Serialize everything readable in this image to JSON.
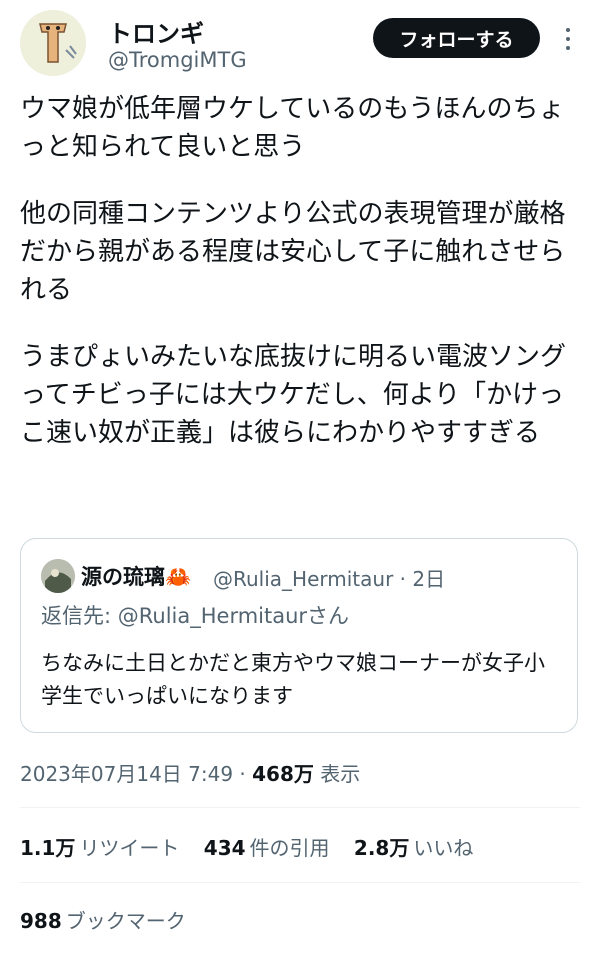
{
  "author": {
    "name": "トロンギ",
    "handle": "@TromgiMTG",
    "avatar_icon": "cartoon-character-avatar-icon"
  },
  "follow_button": {
    "label": "フォローする"
  },
  "more_button": {
    "icon": "more-options-icon"
  },
  "tweet": {
    "paragraphs": [
      "ウマ娘が低年層ウケしているのもうほんのちょっと知られて良いと思う",
      "他の同種コンテンツより公式の表現管理が厳格だから親がある程度は安心して子に触れさせられる",
      "うまぴょいみたいな底抜けに明るい電波ソングってチビっ子には大ウケだし、何より「かけっこ速い奴が正義」は彼らにわかりやすすぎる"
    ]
  },
  "quote": {
    "author_name": "源の琉璃🦀",
    "author_handle_time": "@Rulia_Hermitaur · 2日",
    "reply_to": "返信先: @Rulia_Hermitaurさん",
    "text": "ちなみに土日とかだと東方やウマ娘コーナーが女子小学生でいっぱいになります",
    "avatar_icon": "user-photo-avatar-icon"
  },
  "meta": {
    "timestamp": "2023年07月14日 7:49 · ",
    "views_count": "468万",
    "views_label": " 表示"
  },
  "stats": {
    "retweets_count": "1.1万",
    "retweets_label": "リツイート",
    "quotes_count": "434",
    "quotes_label": "件の引用",
    "likes_count": "2.8万",
    "likes_label": "いいね"
  },
  "bookmarks": {
    "count": "988",
    "label": "ブックマーク"
  },
  "colors": {
    "text": "#0f1419",
    "secondary": "#536471",
    "border": "#cfd9de",
    "follow_bg": "#0f1419"
  }
}
